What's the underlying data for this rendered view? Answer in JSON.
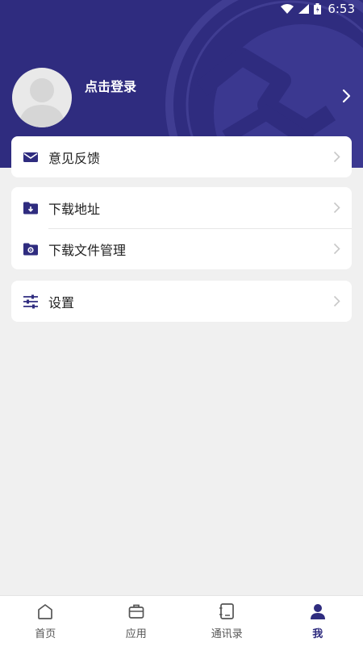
{
  "status_bar": {
    "time": "6:53"
  },
  "profile": {
    "login_text": "点击登录"
  },
  "menu": {
    "feedback": "意见反馈",
    "download_address": "下载地址",
    "download_files": "下载文件管理",
    "settings": "设置"
  },
  "tabbar": {
    "items": [
      {
        "label": "首页",
        "icon": "home-icon"
      },
      {
        "label": "应用",
        "icon": "briefcase-icon"
      },
      {
        "label": "通讯录",
        "icon": "contacts-icon"
      },
      {
        "label": "我",
        "icon": "person-icon"
      }
    ],
    "active_index": 3
  },
  "colors": {
    "primary": "#2f2c7f",
    "background": "#f0f0f0",
    "card": "#ffffff"
  }
}
